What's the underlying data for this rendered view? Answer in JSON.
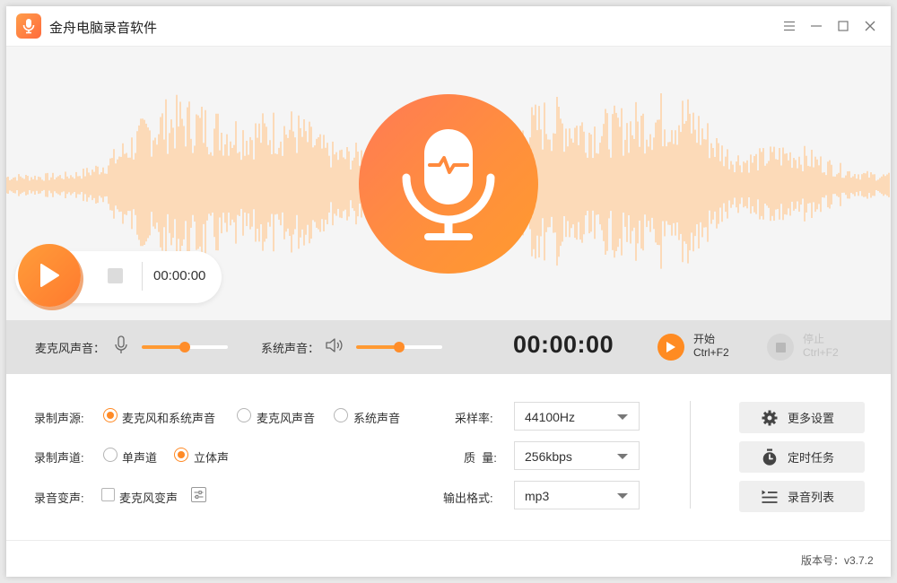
{
  "app": {
    "title": "金舟电脑录音软件"
  },
  "colors": {
    "accent": "#ff8a26",
    "waveform": "#ffcf9e"
  },
  "titlebar_icons": [
    "menu-icon",
    "minimize-icon",
    "maximize-icon",
    "close-icon"
  ],
  "player": {
    "time": "00:00:00"
  },
  "volume": {
    "mic_label": "麦克风声音：",
    "mic_level": 0.5,
    "system_label": "系统声音：",
    "system_level": 0.5
  },
  "recording": {
    "time": "00:00:00",
    "start_label": "开始",
    "start_shortcut": "Ctrl+F2",
    "stop_label": "停止",
    "stop_shortcut": "Ctrl+F2"
  },
  "settings": {
    "source_label": "录制声源:",
    "source_options": [
      "麦克风和系统声音",
      "麦克风声音",
      "系统声音"
    ],
    "source_selected": "麦克风和系统声音",
    "channel_label": "录制声道:",
    "channel_options": [
      "单声道",
      "立体声"
    ],
    "channel_selected": "立体声",
    "voice_change_label": "录音变声:",
    "voice_change_option": "麦克风变声",
    "voice_change_checked": false,
    "sample_rate_label": "采样率:",
    "sample_rate_value": "44100Hz",
    "quality_label": "质  量:",
    "quality_value": "256kbps",
    "format_label": "输出格式:",
    "format_value": "mp3"
  },
  "actions": {
    "more_settings": "更多设置",
    "scheduled_task": "定时任务",
    "recording_list": "录音列表"
  },
  "footer": {
    "version": "版本号：v3.7.2"
  }
}
